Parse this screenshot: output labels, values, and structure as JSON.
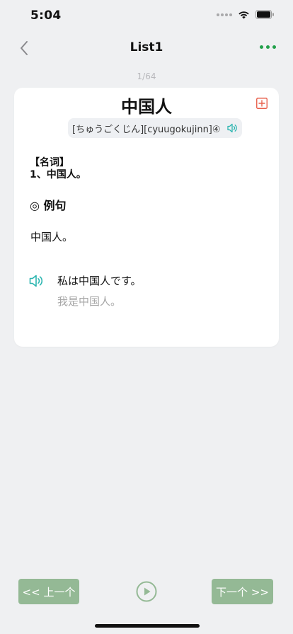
{
  "status_bar": {
    "time": "5:04"
  },
  "nav": {
    "title": "List1"
  },
  "page_counter": "1/64",
  "word": {
    "title": "中国人",
    "reading": "[ちゅうごくじん][cyuugokujinn]④",
    "part_of_speech": "【名词】",
    "meaning": "1、中国人。"
  },
  "examples": {
    "header": "◎ 例句",
    "word": "中国人。",
    "sentence_jp": "私は中国人です。",
    "sentence_cn": "我是中国人。"
  },
  "controls": {
    "prev_label": "<< 上一个",
    "next_label": "下一个 >>"
  },
  "colors": {
    "accent_green": "#21a04a",
    "button_green": "#94b995",
    "speaker_teal": "#2bb5b0",
    "add_red": "#e8604c",
    "background": "#eff0f2"
  }
}
